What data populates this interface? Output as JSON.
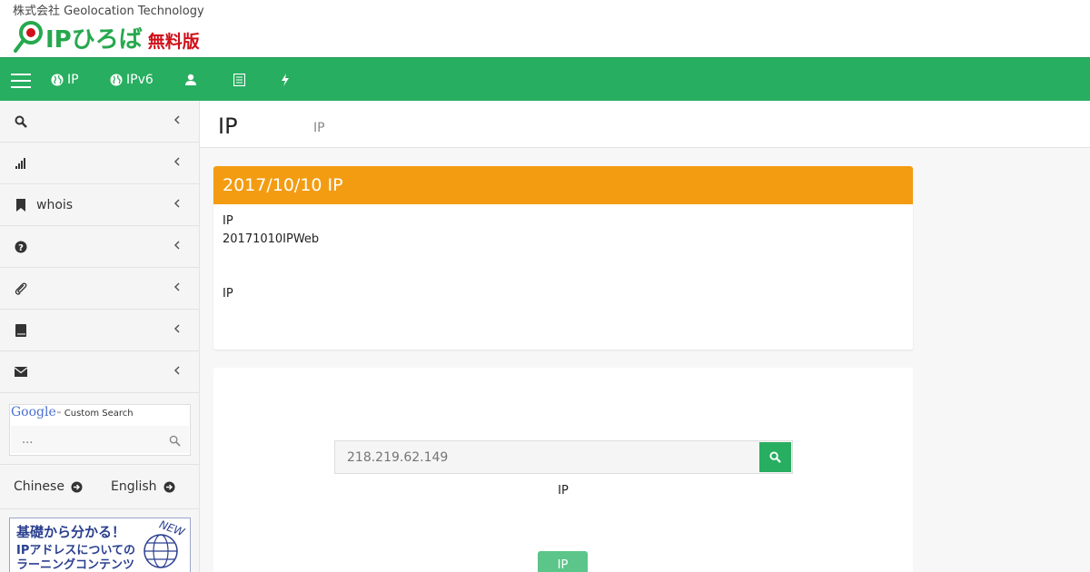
{
  "header": {
    "company": "株式会社 Geolocation Technology",
    "logo_text": "IPひろば",
    "logo_edition": "無料版"
  },
  "nav": {
    "items": [
      {
        "label": "IP",
        "icon": "globe-icon"
      },
      {
        "label": "IPv6",
        "icon": "globe-icon"
      },
      {
        "label": "",
        "icon": "user-icon"
      },
      {
        "label": "",
        "icon": "list-icon"
      },
      {
        "label": "",
        "icon": "bolt-icon"
      }
    ]
  },
  "sidebar": {
    "items": [
      {
        "label": "",
        "icon": "search-icon"
      },
      {
        "label": "",
        "icon": "bar-chart-icon"
      },
      {
        "label": "whois",
        "icon": "bookmark-icon"
      },
      {
        "label": "",
        "icon": "question-icon"
      },
      {
        "label": "",
        "icon": "paperclip-icon"
      },
      {
        "label": "",
        "icon": "book-icon"
      },
      {
        "label": "",
        "icon": "envelope-icon"
      }
    ],
    "google_search": {
      "brand": "Google",
      "brand_suffix": "Custom Search",
      "placeholder": "..."
    },
    "languages": [
      "Chinese",
      "English"
    ],
    "banner": {
      "line1": "基礎から分かる！",
      "line2": "IPアドレスについての",
      "line3": "ラーニングコンテンツ",
      "badge": "NEW"
    }
  },
  "main": {
    "title": "IP",
    "subtitle": "IP",
    "notice": {
      "heading": "2017/10/10 IP",
      "line1": "IP",
      "line2": "20171010IPWeb",
      "line3": "IP"
    },
    "search": {
      "placeholder": "218.219.62.149",
      "caption": "IP",
      "submit": "IP"
    }
  },
  "colors": {
    "brand_green": "#27ae60",
    "notice_orange": "#f39c12",
    "logo_red": "#d0101a"
  }
}
